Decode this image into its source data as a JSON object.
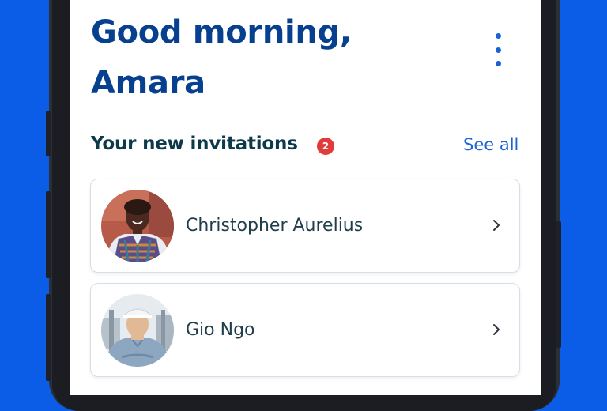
{
  "greeting": {
    "line1": "Good morning,",
    "line2": "Amara"
  },
  "menu_icon": "more-vertical-icon",
  "invitations": {
    "title": "Your new invitations",
    "count": "2",
    "see_all_label": "See all",
    "items": [
      {
        "name": "Christopher Aurelius",
        "avatar_icon": "profile-photo"
      },
      {
        "name": "Gio Ngo",
        "avatar_icon": "profile-photo"
      }
    ]
  },
  "colors": {
    "background": "#0b5ce6",
    "heading": "#07408f",
    "accent": "#1a63d6",
    "badge": "#e23b3b"
  }
}
